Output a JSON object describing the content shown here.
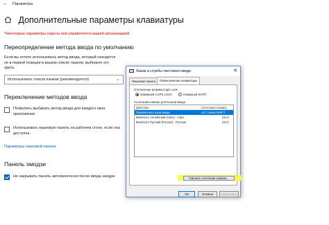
{
  "window": {
    "title": "Параметры",
    "back_glyph": "←"
  },
  "page": {
    "title": "Дополнительные параметры клавиатуры"
  },
  "warning": "*Некоторые параметры скрыты или управляются вашей организацией.",
  "default_input": {
    "heading": "Переопределение метода ввода по умолчанию",
    "description_line1": "Если вы хотите использовать метод ввода, который находится",
    "description_line2": "не в первой позиции в вашем списке языков, выберите его",
    "description_line3": "здесь.",
    "select_value": "Использовать список языков (рекомендуется)"
  },
  "switch_methods": {
    "heading": "Переключение методов ввода",
    "cb1_line1": "Позволить выбирать метод ввода для каждого окна",
    "cb1_line2": "приложения",
    "cb2_line1": "Использовать языковую панель на рабочем столе, если она",
    "cb2_line2": "доступна",
    "link": "Параметры языковой панели"
  },
  "emoji": {
    "heading": "Панель эмодзи",
    "cb_label": "Не закрывать панель автоматически после ввода эмодзи"
  },
  "dialog": {
    "title": "Языки и службы текстового ввода",
    "tabs": [
      "Языковая панель",
      "Переключение клавиатуры"
    ],
    "capslock_group": "Отключение режима Caps Lock",
    "radio_caps": "Клавишей CAPS LOCK",
    "radio_shift": "Клавишей SHIFT",
    "hotkeys_group": "Сочетания клавиш для языков ввода",
    "col_action": "Действие",
    "col_keys": "Сочетание клавиш",
    "rows": [
      {
        "action": "Переключить язык ввода",
        "keys": "ALT слева+SHIFT"
      },
      {
        "action": "Включить Английский (США) - США",
        "keys": "(Нет)"
      },
      {
        "action": "Включить Русский (Россия) - Русская",
        "keys": "(Нет)"
      }
    ],
    "change_btn": "Сменить сочетание клавиш...",
    "ok": "ОК",
    "cancel": "Отмена",
    "apply": "Применить"
  },
  "colors": {
    "accent": "#0078d7",
    "warning": "#d00000",
    "highlight": "#f7ff30"
  }
}
